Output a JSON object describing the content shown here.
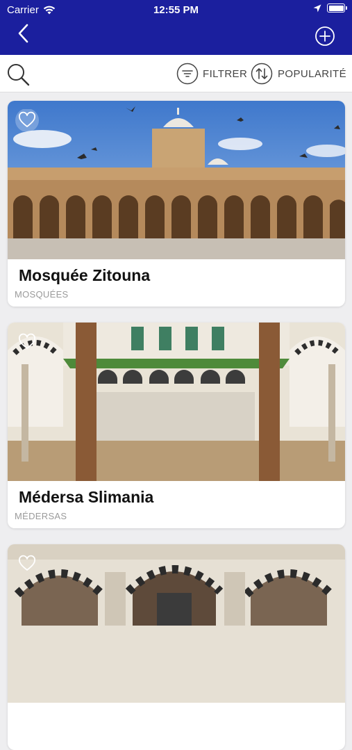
{
  "status_bar": {
    "carrier": "Carrier",
    "time": "12:55 PM"
  },
  "header": {
    "back_icon": "chevron-left-icon",
    "add_icon": "plus-circle-icon"
  },
  "toolbar": {
    "filter_label": "FILTRER",
    "sort_label": "POPULARITÉ"
  },
  "colors": {
    "nav_bar": "#1b1f9e",
    "background": "#eeeef0",
    "card": "#ffffff"
  },
  "places": [
    {
      "title": "Mosquée Zitouna",
      "category": "MOSQUÉES"
    },
    {
      "title": "Médersa Slimania",
      "category": "MÉDERSAS"
    },
    {
      "title": "",
      "category": ""
    }
  ]
}
